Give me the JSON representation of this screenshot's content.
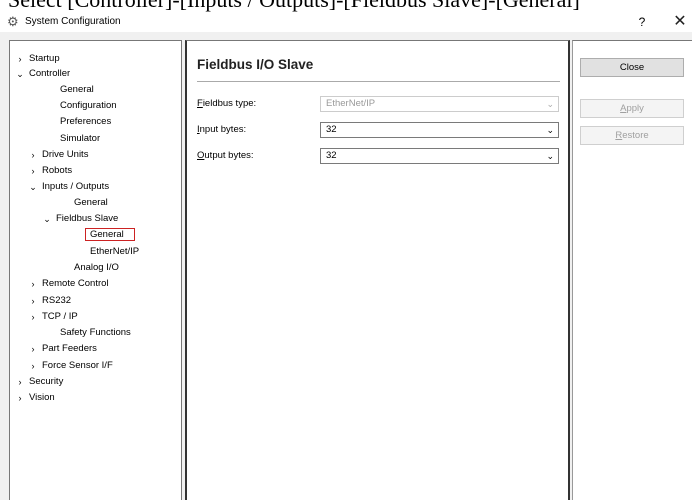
{
  "caption": "Select [Controller]-[Inputs / Outputs]-[Fieldbus Slave]-[General]",
  "window": {
    "title": "System Configuration",
    "help_label": "?",
    "close_label": "✕"
  },
  "tree": {
    "items": [
      {
        "label": "Startup",
        "chevron": "›"
      },
      {
        "label": "Controller",
        "chevron": "⌄"
      },
      {
        "label": "General"
      },
      {
        "label": "Configuration"
      },
      {
        "label": "Preferences"
      },
      {
        "label": "Simulator"
      },
      {
        "label": "Drive Units",
        "chevron": "›"
      },
      {
        "label": "Robots",
        "chevron": "›"
      },
      {
        "label": "Inputs / Outputs",
        "chevron": "⌄"
      },
      {
        "label": "General"
      },
      {
        "label": "Fieldbus Slave",
        "chevron": "⌄"
      },
      {
        "label": "General",
        "selected": true
      },
      {
        "label": "EtherNet/IP"
      },
      {
        "label": "Analog I/O"
      },
      {
        "label": "Remote Control",
        "chevron": "›"
      },
      {
        "label": "RS232",
        "chevron": "›"
      },
      {
        "label": "TCP / IP",
        "chevron": "›"
      },
      {
        "label": "Safety Functions"
      },
      {
        "label": "Part Feeders",
        "chevron": "›"
      },
      {
        "label": "Force Sensor I/F",
        "chevron": "›"
      },
      {
        "label": "Security",
        "chevron": "›"
      },
      {
        "label": "Vision",
        "chevron": "›"
      }
    ]
  },
  "main": {
    "title": "Fieldbus I/O Slave",
    "fields": [
      {
        "label_mnemonic": "F",
        "label_rest": "ieldbus type:",
        "value": "EtherNet/IP",
        "disabled": true
      },
      {
        "label_mnemonic": "I",
        "label_rest": "nput bytes:",
        "value": "32",
        "disabled": false
      },
      {
        "label_mnemonic": "O",
        "label_rest": "utput bytes:",
        "value": "32",
        "disabled": false
      }
    ]
  },
  "actions": {
    "close_label": "Close",
    "apply_mnemonic": "A",
    "apply_rest": "pply",
    "restore_mnemonic": "R",
    "restore_rest": "estore"
  },
  "icons": {
    "gear": "gear-icon",
    "chevron_collapsed": "chevron-right-icon",
    "chevron_expanded": "chevron-down-icon",
    "dropdown": "chevron-down-icon"
  },
  "colors": {
    "selection_border": "#cc2222",
    "pane_border": "#333333",
    "disabled_text": "#a0a0a0"
  }
}
